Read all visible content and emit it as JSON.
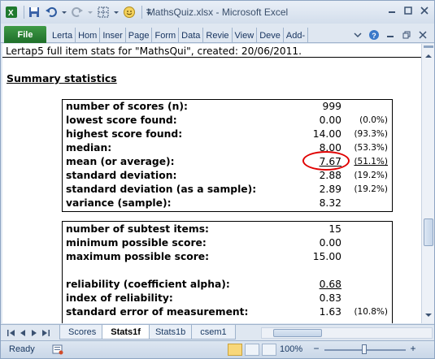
{
  "window": {
    "title": "MathsQuiz.xlsx - Microsoft Excel"
  },
  "ribbon": {
    "file_label": "File",
    "tabs": [
      "Lerta",
      "Hom",
      "Inser",
      "Page",
      "Form",
      "Data",
      "Revie",
      "View",
      "Deve",
      "Add-"
    ]
  },
  "sheet": {
    "header": "Lertap5 full item stats for \"MathsQui\", created: 20/06/2011.",
    "summary_title": "Summary statistics",
    "box1": [
      {
        "label": "number of scores (n):",
        "value": "999",
        "pct": ""
      },
      {
        "label": "lowest score found:",
        "value": "0.00",
        "pct": "(0.0%)"
      },
      {
        "label": "highest score found:",
        "value": "14.00",
        "pct": "(93.3%)"
      },
      {
        "label": "median:",
        "value": "8.00",
        "pct": "(53.3%)"
      },
      {
        "label": "mean (or average):",
        "value": "7.67",
        "pct": "(51.1%)"
      },
      {
        "label": "standard deviation:",
        "value": "2.88",
        "pct": "(19.2%)"
      },
      {
        "label": "standard deviation (as a sample):",
        "value": "2.89",
        "pct": "(19.2%)"
      },
      {
        "label": "variance (sample):",
        "value": "8.32",
        "pct": ""
      }
    ],
    "box2": [
      {
        "label": "number of subtest items:",
        "value": "15",
        "pct": ""
      },
      {
        "label": "minimum possible score:",
        "value": "0.00",
        "pct": ""
      },
      {
        "label": "maximum possible score:",
        "value": "15.00",
        "pct": ""
      },
      {
        "label": "",
        "value": "",
        "pct": ""
      },
      {
        "label": "reliability (coefficient alpha):",
        "value": "0.68",
        "pct": ""
      },
      {
        "label": "index of reliability:",
        "value": "0.83",
        "pct": ""
      },
      {
        "label": "standard error of measurement:",
        "value": "1.63",
        "pct": "(10.8%)"
      }
    ]
  },
  "sheet_tabs": [
    "Scores",
    "Stats1f",
    "Stats1b",
    "csem1"
  ],
  "active_sheet": "Stats1f",
  "status": {
    "ready": "Ready",
    "zoom": "100%"
  },
  "colors": {
    "highlight_ring": "#e00000",
    "file_tab": "#2a7a33"
  }
}
